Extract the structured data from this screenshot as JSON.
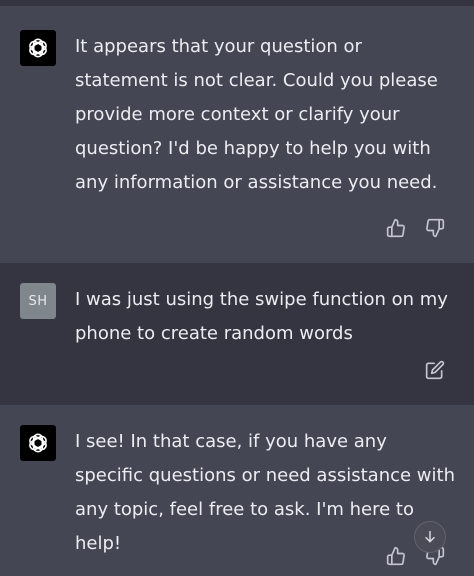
{
  "messages": [
    {
      "role": "assistant",
      "avatar_icon": "openai-logo-icon",
      "text": "It appears that your question or statement is not clear. Could you please provide more context or clarify your question? I'd be happy to help you with any information or assistance you need.",
      "actions": [
        "thumbs-up-icon",
        "thumbs-down-icon"
      ]
    },
    {
      "role": "user",
      "avatar_initials": "SH",
      "text": "I was just using the swipe function on my phone to create random words",
      "actions": [
        "edit-icon"
      ]
    },
    {
      "role": "assistant",
      "avatar_icon": "openai-logo-icon",
      "text": "I see! In that case, if you have any specific questions or need assistance with any topic, feel free to ask. I'm here to help!",
      "actions": [
        "thumbs-up-icon",
        "thumbs-down-icon"
      ]
    }
  ],
  "scroll_button_icon": "arrow-down-icon",
  "colors": {
    "assistant_bg": "#444654",
    "user_bg": "#343541",
    "text": "#ececf1",
    "icon": "#c5c5d2",
    "user_avatar_bg": "#7f868c"
  }
}
